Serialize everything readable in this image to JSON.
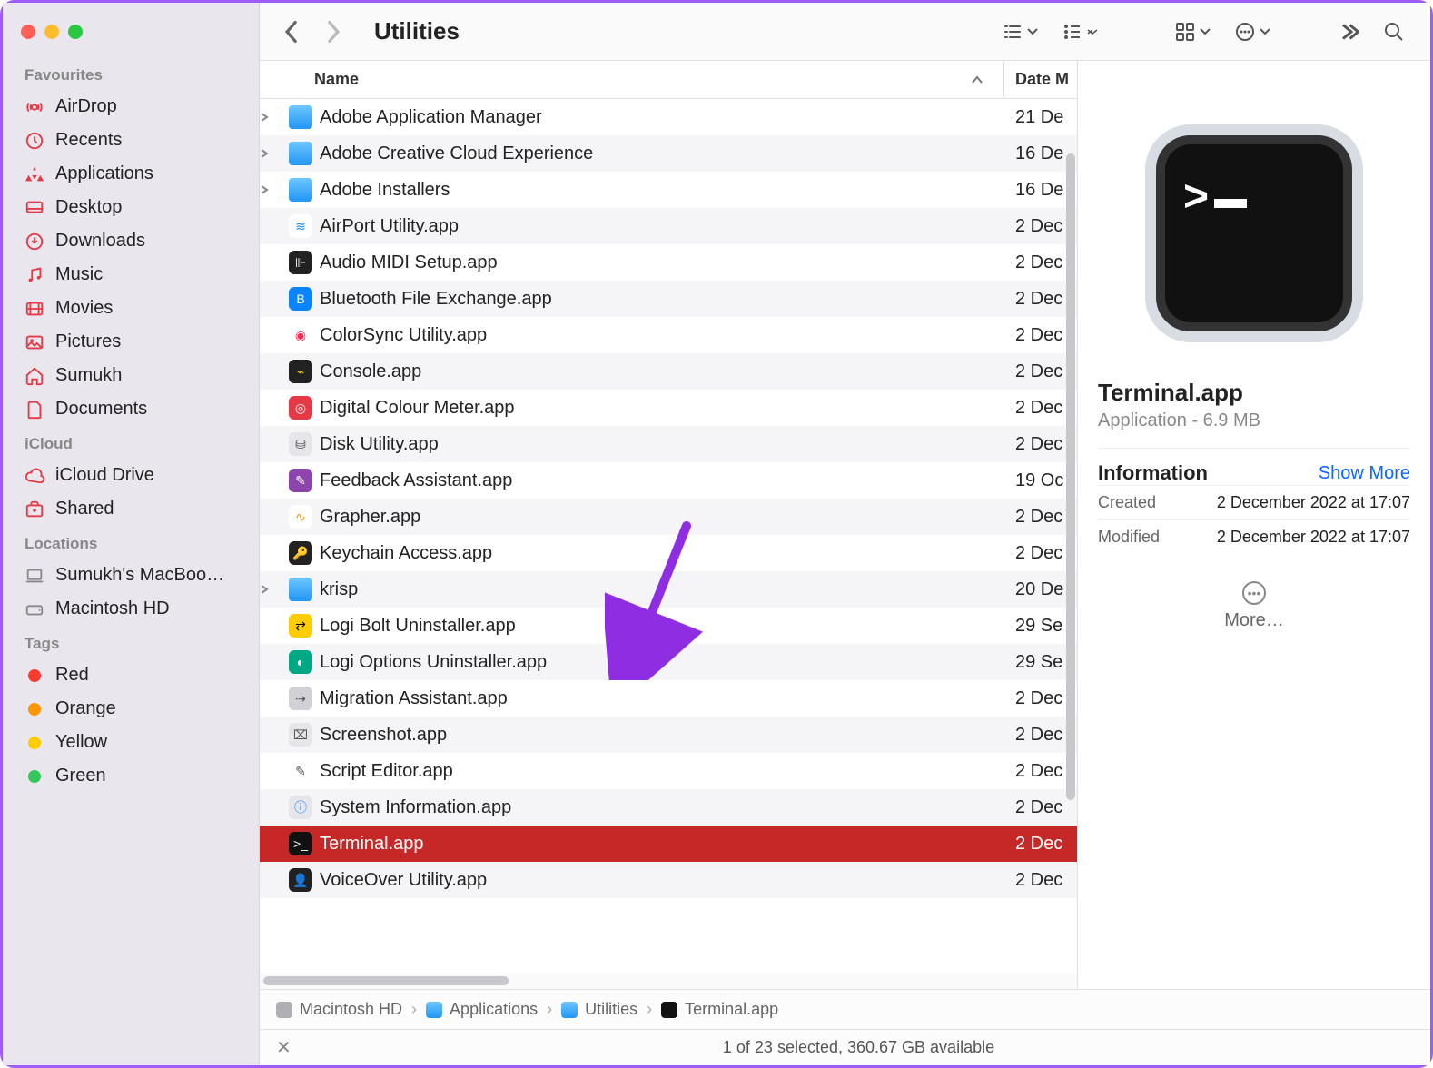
{
  "traffic_lights": [
    "close",
    "minimize",
    "zoom"
  ],
  "sidebar": {
    "sections": [
      {
        "title": "Favourites",
        "items": [
          {
            "icon": "airdrop-icon",
            "label": "AirDrop"
          },
          {
            "icon": "clock-icon",
            "label": "Recents"
          },
          {
            "icon": "apps-icon",
            "label": "Applications"
          },
          {
            "icon": "desktop-icon",
            "label": "Desktop"
          },
          {
            "icon": "download-icon",
            "label": "Downloads"
          },
          {
            "icon": "music-icon",
            "label": "Music"
          },
          {
            "icon": "movies-icon",
            "label": "Movies"
          },
          {
            "icon": "pictures-icon",
            "label": "Pictures"
          },
          {
            "icon": "home-icon",
            "label": "Sumukh"
          },
          {
            "icon": "document-icon",
            "label": "Documents"
          }
        ]
      },
      {
        "title": "iCloud",
        "items": [
          {
            "icon": "cloud-icon",
            "label": "iCloud Drive"
          },
          {
            "icon": "shared-icon",
            "label": "Shared"
          }
        ]
      },
      {
        "title": "Locations",
        "items": [
          {
            "icon": "laptop-icon",
            "label": "Sumukh's MacBoo…",
            "gray": true
          },
          {
            "icon": "hd-icon",
            "label": "Macintosh HD",
            "gray": true
          }
        ]
      },
      {
        "title": "Tags",
        "items": [
          {
            "icon": "tag-dot",
            "color": "#ff3b30",
            "label": "Red"
          },
          {
            "icon": "tag-dot",
            "color": "#ff9500",
            "label": "Orange"
          },
          {
            "icon": "tag-dot",
            "color": "#ffcc00",
            "label": "Yellow"
          },
          {
            "icon": "tag-dot",
            "color": "#34c759",
            "label": "Green"
          }
        ]
      }
    ]
  },
  "toolbar": {
    "title": "Utilities"
  },
  "columns": {
    "name": "Name",
    "date": "Date M"
  },
  "files": [
    {
      "name": "Adobe Application Manager",
      "date": "21 De",
      "type": "folder",
      "disc": true
    },
    {
      "name": "Adobe Creative Cloud Experience",
      "date": "16 De",
      "type": "folder",
      "disc": true
    },
    {
      "name": "Adobe Installers",
      "date": "16 De",
      "type": "folder",
      "disc": true
    },
    {
      "name": "AirPort Utility.app",
      "date": "2 Dec",
      "type": "app",
      "bg": "#fff",
      "fg": "#0a84ff",
      "glyph": "≋"
    },
    {
      "name": "Audio MIDI Setup.app",
      "date": "2 Dec",
      "type": "app",
      "bg": "#222",
      "fg": "#fff",
      "glyph": "⊪"
    },
    {
      "name": "Bluetooth File Exchange.app",
      "date": "2 Dec",
      "type": "app",
      "bg": "#0a84ff",
      "fg": "#fff",
      "glyph": "B"
    },
    {
      "name": "ColorSync Utility.app",
      "date": "2 Dec",
      "type": "app",
      "bg": "#fff",
      "fg": "#ff2d55",
      "glyph": "◉"
    },
    {
      "name": "Console.app",
      "date": "2 Dec",
      "type": "app",
      "bg": "#222",
      "fg": "#ffcc00",
      "glyph": "⌁"
    },
    {
      "name": "Digital Colour Meter.app",
      "date": "2 Dec",
      "type": "app",
      "bg": "#e63946",
      "fg": "#fff",
      "glyph": "◎"
    },
    {
      "name": "Disk Utility.app",
      "date": "2 Dec",
      "type": "app",
      "bg": "#e5e5ea",
      "fg": "#555",
      "glyph": "⛁"
    },
    {
      "name": "Feedback Assistant.app",
      "date": "19 Oc",
      "type": "app",
      "bg": "#8e44ad",
      "fg": "#fff",
      "glyph": "✎"
    },
    {
      "name": "Grapher.app",
      "date": "2 Dec",
      "type": "app",
      "bg": "#fff",
      "fg": "#ff9500",
      "glyph": "∿"
    },
    {
      "name": "Keychain Access.app",
      "date": "2 Dec",
      "type": "app",
      "bg": "#222",
      "fg": "#ddd",
      "glyph": "🔑"
    },
    {
      "name": "krisp",
      "date": "20 De",
      "type": "folder",
      "disc": true
    },
    {
      "name": "Logi Bolt Uninstaller.app",
      "date": "29 Se",
      "type": "app",
      "bg": "#ffcc00",
      "fg": "#000",
      "glyph": "⇄"
    },
    {
      "name": "Logi Options Uninstaller.app",
      "date": "29 Se",
      "type": "app",
      "bg": "#00a884",
      "fg": "#fff",
      "glyph": "◐"
    },
    {
      "name": "Migration Assistant.app",
      "date": "2 Dec",
      "type": "app",
      "bg": "#d0d0d6",
      "fg": "#555",
      "glyph": "⇢"
    },
    {
      "name": "Screenshot.app",
      "date": "2 Dec",
      "type": "app",
      "bg": "#e5e5ea",
      "fg": "#555",
      "glyph": "⌧"
    },
    {
      "name": "Script Editor.app",
      "date": "2 Dec",
      "type": "app",
      "bg": "#fff",
      "fg": "#555",
      "glyph": "✎"
    },
    {
      "name": "System Information.app",
      "date": "2 Dec",
      "type": "app",
      "bg": "#e5e5ea",
      "fg": "#0a84ff",
      "glyph": "ⓘ"
    },
    {
      "name": "Terminal.app",
      "date": "2 Dec",
      "type": "app",
      "bg": "#111",
      "fg": "#fff",
      "glyph": ">_",
      "selected": true
    },
    {
      "name": "VoiceOver Utility.app",
      "date": "2 Dec",
      "type": "app",
      "bg": "#222",
      "fg": "#fff",
      "glyph": "👤"
    }
  ],
  "preview": {
    "title": "Terminal.app",
    "subtitle": "Application - 6.9 MB",
    "info_label": "Information",
    "show_more": "Show More",
    "rows": [
      {
        "k": "Created",
        "v": "2 December 2022 at 17:07"
      },
      {
        "k": "Modified",
        "v": "2 December 2022 at 17:07"
      }
    ],
    "more": "More…"
  },
  "pathbar": [
    {
      "icon": "hd",
      "label": "Macintosh HD"
    },
    {
      "icon": "folder",
      "label": "Applications"
    },
    {
      "icon": "folder",
      "label": "Utilities"
    },
    {
      "icon": "term",
      "label": "Terminal.app"
    }
  ],
  "statusbar": "1 of 23 selected, 360.67 GB available"
}
